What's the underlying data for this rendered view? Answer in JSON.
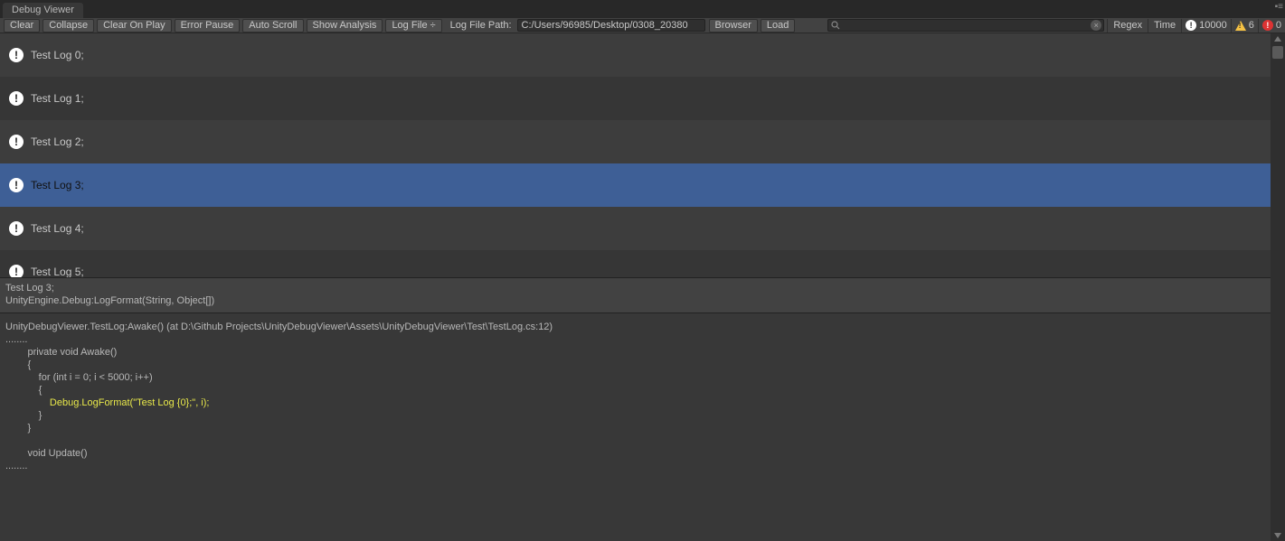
{
  "tab": {
    "title": "Debug Viewer"
  },
  "toolbar": {
    "clear": "Clear",
    "collapse": "Collapse",
    "clear_on_play": "Clear On Play",
    "error_pause": "Error Pause",
    "auto_scroll": "Auto Scroll",
    "show_analysis": "Show Analysis",
    "log_file": "Log File ÷",
    "log_file_path_label": "Log File Path:",
    "log_file_path_value": "C:/Users/96985/Desktop/0308_20380",
    "browser": "Browser",
    "load": "Load",
    "regex": "Regex",
    "time": "Time"
  },
  "counters": {
    "info": "10000",
    "warn": "6",
    "error": "0"
  },
  "logs": [
    {
      "text": "Test Log 0;",
      "selected": false
    },
    {
      "text": "Test Log 1;",
      "selected": false
    },
    {
      "text": "Test Log 2;",
      "selected": false
    },
    {
      "text": "Test Log 3;",
      "selected": true
    },
    {
      "text": "Test Log 4;",
      "selected": false
    },
    {
      "text": "Test Log 5;",
      "selected": false
    }
  ],
  "detail": {
    "line1": "Test Log 3;",
    "line2": "UnityEngine.Debug:LogFormat(String, Object[])",
    "stack_head": "UnityDebugViewer.TestLog:Awake() (at D:\\Github Projects\\UnityDebugViewer\\Assets\\UnityDebugViewer\\Test\\TestLog.cs:12)",
    "dots1": "........",
    "code1": "        private void Awake()",
    "code2": "        {",
    "code3": "            for (int i = 0; i < 5000; i++)",
    "code4": "            {",
    "code5_hl": "                Debug.LogFormat(\"Test Log {0};\", i);",
    "code6": "            }",
    "code7": "        }",
    "code8": "",
    "code9": "        void Update()",
    "dots2": "........"
  }
}
